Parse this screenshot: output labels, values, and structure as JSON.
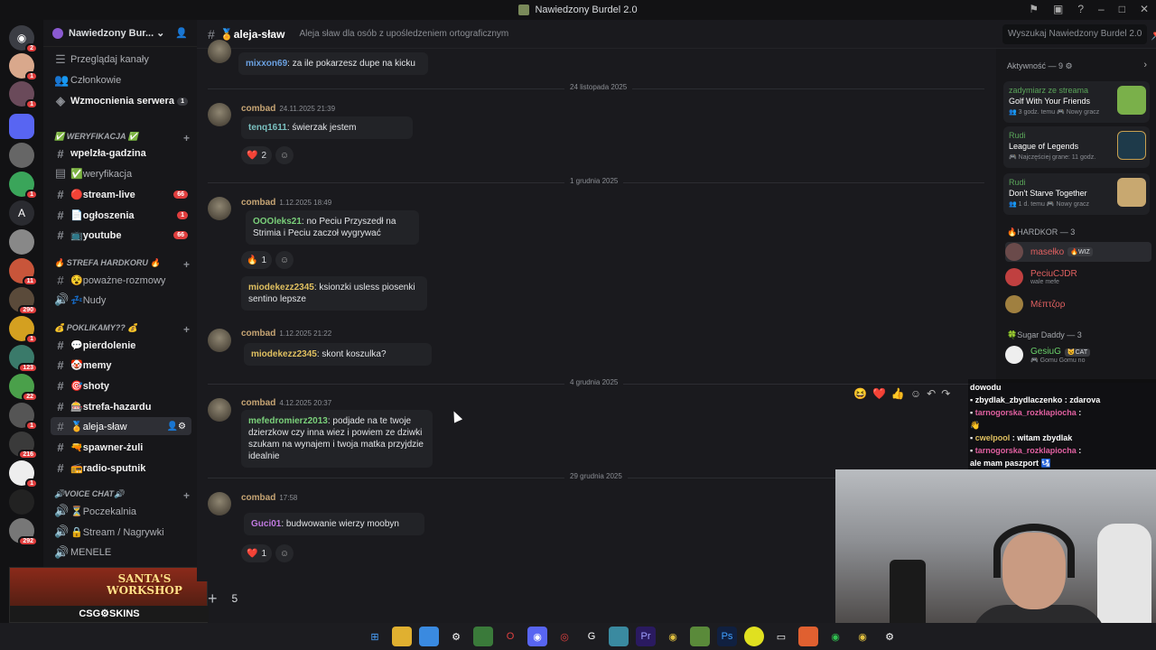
{
  "window": {
    "title": "Nawiedzony Burdel 2.0"
  },
  "servers": {
    "badges": [
      "2",
      "1",
      "1",
      "1",
      "1",
      "11",
      "290",
      "123",
      "22",
      "1",
      "216",
      "1",
      "292"
    ],
    "letter_label": "A"
  },
  "guild": {
    "name": "Nawiedzony Bur..."
  },
  "nav": {
    "browse": "Przeglądaj kanały",
    "members": "Członkowie",
    "boosts": "Wzmocnienia serwera",
    "boosts_count": "1"
  },
  "categories": {
    "verification": "✅ WERYFIKACJA ✅",
    "hardcore": "🔥 STREFA HARDKORU 🔥",
    "poklikamy": "💰 POKLIKAMY?? 💰",
    "voice": "🔊VOICE CHAT🔊"
  },
  "channels": [
    {
      "name": "wpelzła-gadzina"
    },
    {
      "name": "✅weryfikacja"
    },
    {
      "name": "🔴stream-live",
      "count": "66"
    },
    {
      "name": "📄ogłoszenia",
      "count": "1"
    },
    {
      "name": "📺youtube",
      "count": "66"
    },
    {
      "name": "😵poważne-rozmowy"
    },
    {
      "name": "💤Nudy"
    },
    {
      "name": "💬pierdolenie"
    },
    {
      "name": "🤡memy"
    },
    {
      "name": "🎯shoty"
    },
    {
      "name": "🎰strefa-hazardu"
    },
    {
      "name": "🏅aleja-sław"
    },
    {
      "name": "🔫spawner-żuli"
    },
    {
      "name": "📻radio-sputnik"
    },
    {
      "name": "⏳Poczekalnia"
    },
    {
      "name": "🔒Stream / Nagrywki"
    },
    {
      "name": "MENELE"
    }
  ],
  "promo": {
    "title": "SANTA'S WORKSHOP",
    "brand": "CSG⚙SKINS"
  },
  "header": {
    "channel": "🏅aleja-sław",
    "topic": "Aleja sław dla osób z upośledzeniem ortograficznym",
    "search_placeholder": "Wyszukaj Nawiedzony Burdel 2.0"
  },
  "messages": {
    "top_quote": {
      "user": "mixxon69",
      "text": ": za ile pokarzesz dupe na kicku"
    },
    "dates": [
      "24 listopada 2025",
      "1 grudnia 2025",
      "4 grudnia 2025",
      "29 grudnia 2025"
    ],
    "m1": {
      "author": "combad",
      "time": "24.11.2025 21:39",
      "quser": "tenq1611",
      "qtext": ": świerzak jestem",
      "react": "❤️",
      "count": "2"
    },
    "m2": {
      "author": "combad",
      "time": "1.12.2025 18:49",
      "quser": "OOOleks21",
      "qtext": ": no Peciu Przyszedł na Strimia i Peciu zaczoł wygrywać",
      "react": "🔥",
      "count": "1",
      "quser2": "miodekezz2345",
      "qtext2": ": ksionzki usless piosenki sentino lepsze"
    },
    "m3": {
      "author": "combad",
      "time": "1.12.2025 21:22",
      "quser": "miodekezz2345",
      "qtext": ": skont koszulka?"
    },
    "m4": {
      "author": "combad",
      "time": "4.12.2025 20:37",
      "quser": "mefedromierz2013",
      "qtext": ": podjade na te twoje dzierzkow czy inna wiez i powiem ze dziwki szukam na wynajem i twoja matka przyjdzie idealnie"
    },
    "m5": {
      "author": "combad",
      "time": "17:58",
      "quser": "Guci01",
      "qtext": ": budwowanie wierzy moobyn",
      "react": "❤️",
      "count": "1"
    }
  },
  "composer": {
    "value": "5"
  },
  "members": {
    "activity_header": "Aktywność — 9 ⚙",
    "cards": [
      {
        "who": "zadymiarz ze streama",
        "game": "Golf With Your Friends",
        "meta": "👥 3 godz. temu  🎮 Nowy gracz"
      },
      {
        "who": "Rudi",
        "game": "League of Legends",
        "meta": "🎮 Najczęściej grane: 11 godz."
      },
      {
        "who": "Rudi",
        "game": "Don't Starve Together",
        "meta": "👥 1 d. temu  🎮 Nowy gracz"
      }
    ],
    "hardkor_header": "🔥HARDKOR — 3",
    "hardkor": [
      {
        "name": "masełko",
        "tag": "🔥WIZ"
      },
      {
        "name": "PeciuCJDR",
        "sub": "wale mefe"
      },
      {
        "name": "Μέπτζορ"
      }
    ],
    "sugar_header": "🍀Sugar Daddy — 3",
    "sugar": [
      {
        "name": "GesiuG",
        "tag": "😺CAT",
        "sub": "🎮 Gomu Gomu no"
      }
    ]
  },
  "overlay": {
    "lines": [
      {
        "user": "dowodu",
        "text": ""
      },
      {
        "user": "zbydlak_zbydlaczenko",
        "text": " : zdarova"
      },
      {
        "user": "tarnogorska_rozklapiocha",
        "text": " :"
      },
      {
        "user": "",
        "text": "👋"
      },
      {
        "user": "cwelpool",
        "text": " : witam zbydlak"
      },
      {
        "user": "tarnogorska_rozklapiocha",
        "text": " :"
      },
      {
        "user": "",
        "text": "ale mam paszport 🛂"
      }
    ]
  },
  "colors": {
    "accent": "#5865f2",
    "danger": "#e03e3e",
    "author": "#c7a574"
  }
}
